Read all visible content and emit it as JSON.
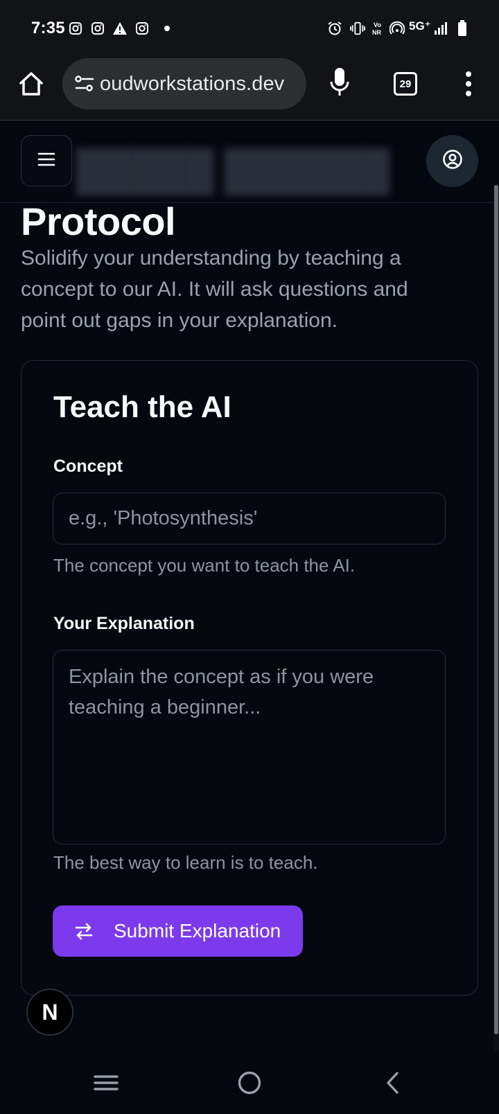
{
  "status_bar": {
    "time": "7:35",
    "network": "5G⁺",
    "left_icons": [
      "instagram-icon",
      "instagram-icon",
      "warning-icon",
      "instagram-icon",
      "dot-icon"
    ],
    "right_icons": [
      "alarm-icon",
      "vibrate-icon",
      "vonr-icon",
      "hotspot-icon",
      "signal-icon",
      "battery-icon"
    ]
  },
  "browser": {
    "url": "oudworkstations.dev",
    "tab_count": "29"
  },
  "page": {
    "title": "Protocol",
    "description": "Solidify your understanding by teaching a concept to our AI. It will ask questions and point out gaps in your explanation."
  },
  "card": {
    "title": "Teach the AI",
    "concept_label": "Concept",
    "concept_placeholder": "e.g., 'Photosynthesis'",
    "concept_help": "The concept you want to teach the AI.",
    "explanation_label": "Your Explanation",
    "explanation_placeholder": "Explain the concept as if you were teaching a beginner...",
    "explanation_help": "The best way to learn is to teach.",
    "submit_label": "Submit Explanation"
  },
  "badge": {
    "label": "N"
  },
  "colors": {
    "accent": "#7c3aed",
    "background": "#05080f",
    "muted_text": "#8e94a0"
  }
}
